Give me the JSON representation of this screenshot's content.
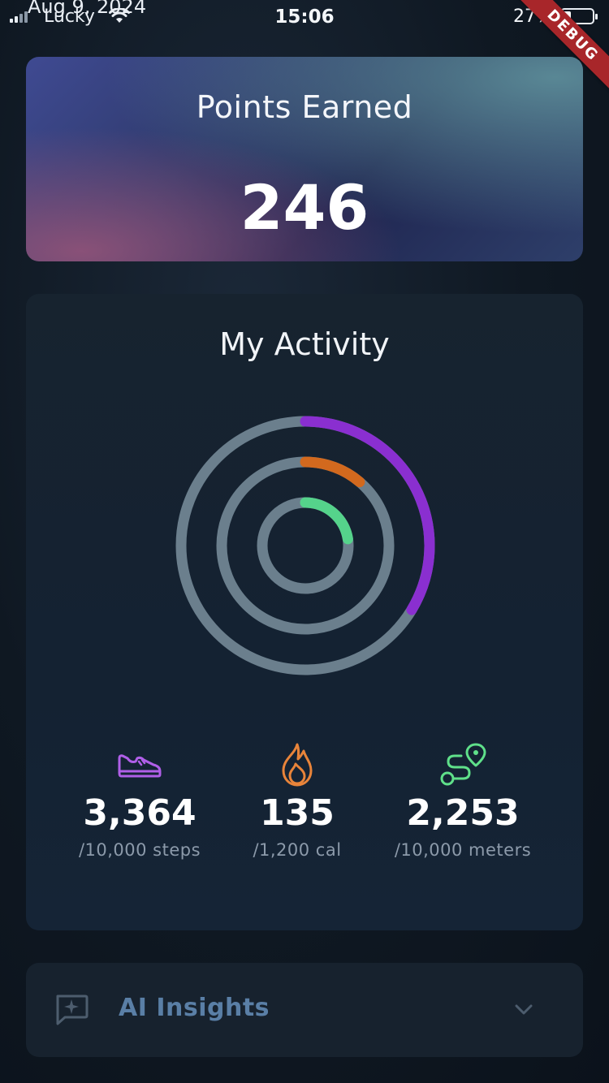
{
  "status_bar": {
    "date": "Aug 9, 2024",
    "carrier": "Lucky",
    "time": "15:06",
    "battery_percent": "27%",
    "battery_level": 0.27,
    "debug_banner": "DEBUG"
  },
  "points": {
    "title": "Points Earned",
    "value": "246"
  },
  "activity": {
    "title": "My Activity",
    "rings": [
      {
        "name": "steps",
        "progress": 0.3364,
        "color": "#8a2fd0"
      },
      {
        "name": "calories",
        "progress": 0.1125,
        "color": "#d2691e"
      },
      {
        "name": "distance",
        "progress": 0.2253,
        "color": "#55d38b"
      }
    ],
    "track_color": "#6b7f8d",
    "stats": [
      {
        "icon": "sneaker-icon",
        "value": "3,364",
        "goal": "/10,000 steps",
        "color": "#b05fe8"
      },
      {
        "icon": "flame-icon",
        "value": "135",
        "goal": "/1,200 cal",
        "color": "#e8843a"
      },
      {
        "icon": "route-icon",
        "value": "2,253",
        "goal": "/10,000 meters",
        "color": "#5fe08a"
      }
    ]
  },
  "ai_insights": {
    "label": "AI Insights",
    "icon": "sparkle-chat-icon",
    "expand_icon": "chevron-down-icon"
  }
}
